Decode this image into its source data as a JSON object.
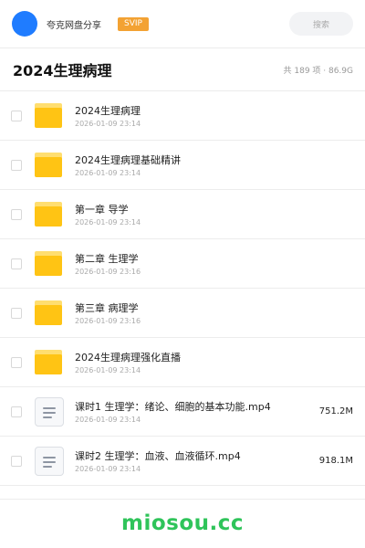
{
  "header": {
    "brand": "夸克网盘分享",
    "badge": "SVIP",
    "search_placeholder": "搜索"
  },
  "folder": {
    "title": "2024生理病理",
    "meta": "共 189 项 · 86.9G"
  },
  "items": [
    {
      "type": "folder",
      "name": "2024生理病理",
      "date": "2026-01-09 23:14",
      "size": ""
    },
    {
      "type": "folder",
      "name": "2024生理病理基础精讲",
      "date": "2026-01-09 23:14",
      "size": ""
    },
    {
      "type": "folder",
      "name": "第一章 导学",
      "date": "2026-01-09 23:14",
      "size": ""
    },
    {
      "type": "folder",
      "name": "第二章 生理学",
      "date": "2026-01-09 23:16",
      "size": ""
    },
    {
      "type": "folder",
      "name": "第三章 病理学",
      "date": "2026-01-09 23:16",
      "size": ""
    },
    {
      "type": "folder",
      "name": "2024生理病理强化直播",
      "date": "2026-01-09 23:14",
      "size": ""
    },
    {
      "type": "file",
      "name": "课时1   生理学：绪论、细胞的基本功能.mp4",
      "date": "2026-01-09 23:14",
      "size": "751.2M"
    },
    {
      "type": "file",
      "name": "课时2   生理学：血液、血液循环.mp4",
      "date": "2026-01-09 23:14",
      "size": "918.1M"
    }
  ],
  "watermark": "miosou.cc"
}
